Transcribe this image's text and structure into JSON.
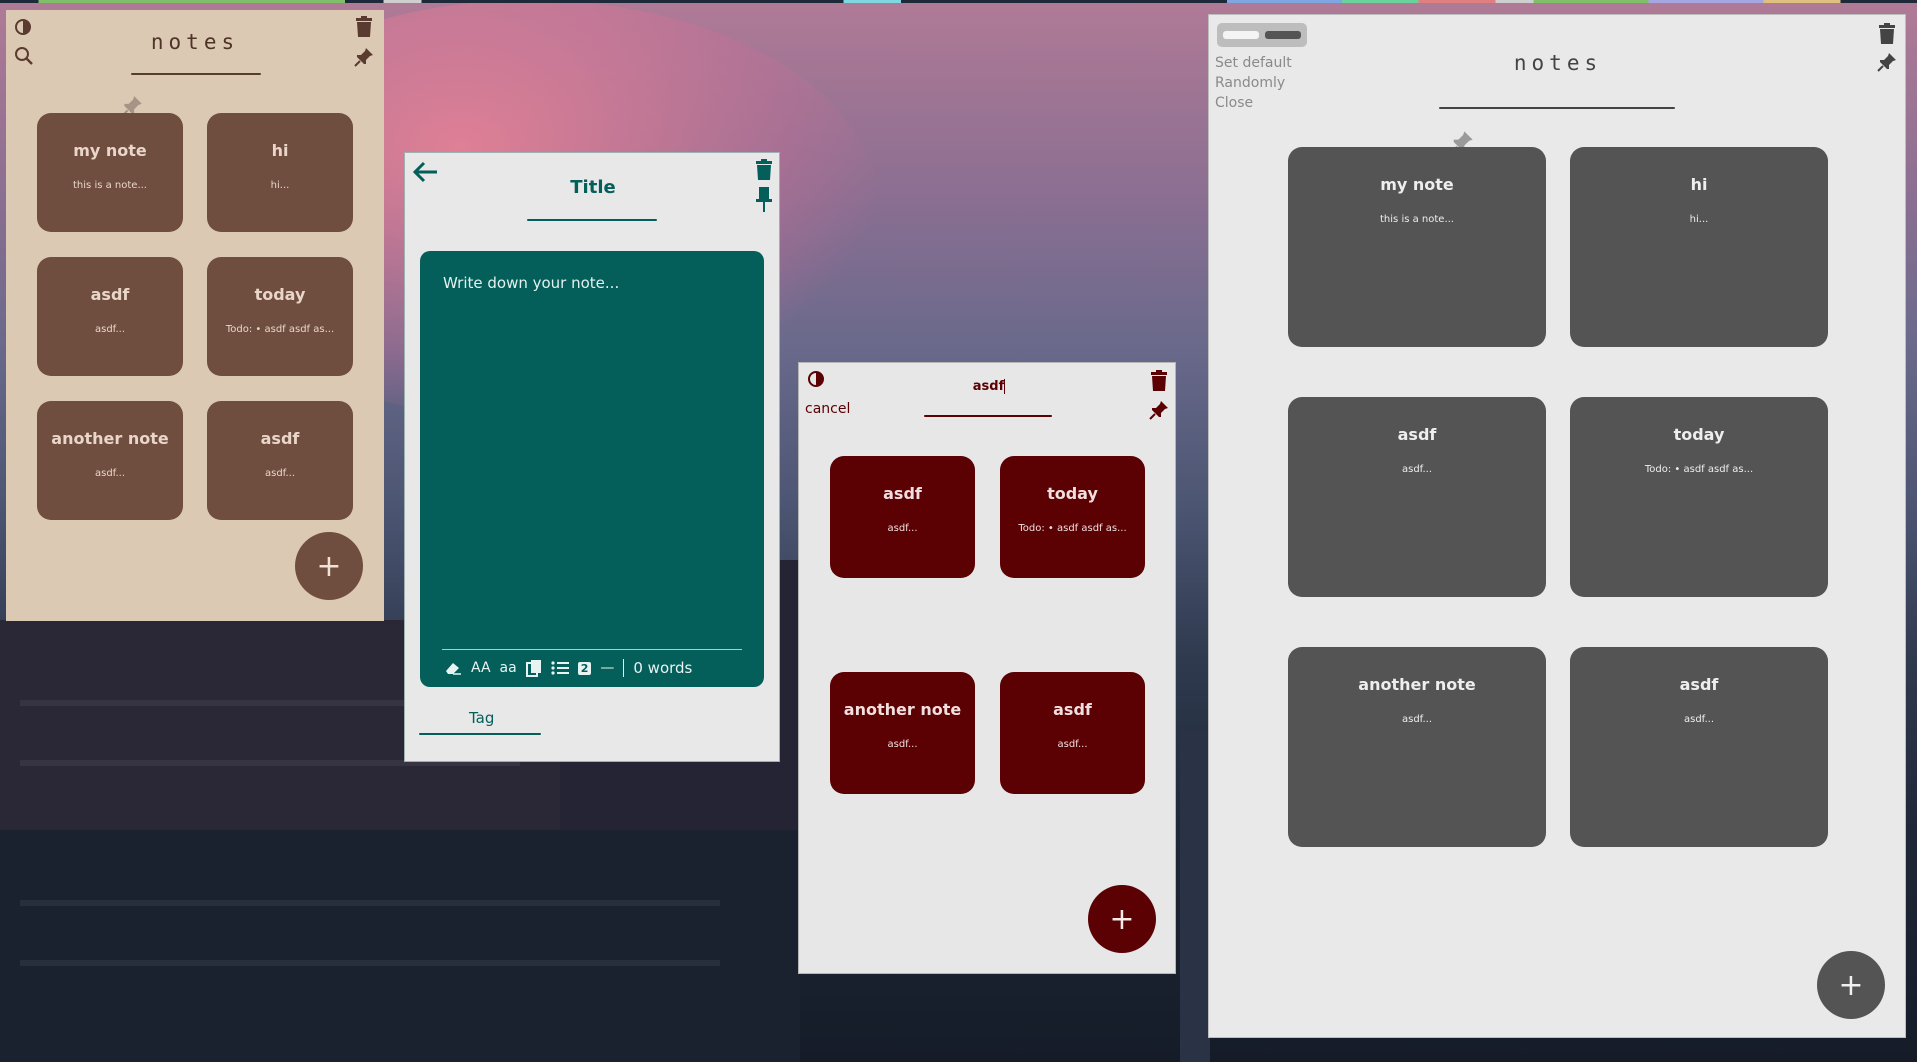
{
  "colors": {
    "tan_bg": "#dcc9b4",
    "tan_card": "#6f4e40",
    "teal": "#045e5a",
    "maroon": "#5b0003",
    "gray_card": "#545454",
    "gray_bg": "#e9e9e9"
  },
  "window_tan": {
    "title": "notes",
    "icons": [
      "contrast-icon",
      "search-icon",
      "trash-icon",
      "pin-icon",
      "pin-icon"
    ],
    "notes": [
      {
        "title": "my note",
        "preview": "this is a note...",
        "pinned": true
      },
      {
        "title": "hi",
        "preview": "hi..."
      },
      {
        "title": "asdf",
        "preview": "asdf..."
      },
      {
        "title": "today",
        "preview": "Todo: • asdf asdf as..."
      },
      {
        "title": "another note",
        "preview": "asdf..."
      },
      {
        "title": "asdf",
        "preview": "asdf..."
      }
    ],
    "fab_label": "+"
  },
  "window_editor": {
    "back_icon": "arrow-left-icon",
    "title_placeholder": "Title",
    "note_placeholder": "Write down your note...",
    "toolbar": {
      "clear_icon": "eraser-icon",
      "uppercase_label": "AA",
      "lowercase_label": "aa",
      "copy_icon": "copy-icon",
      "list_icon": "bullet-list-icon",
      "numbered_label": "2",
      "divider_label": "—",
      "word_count": "0 words"
    },
    "tag_placeholder": "Tag"
  },
  "window_search": {
    "search_value": "asdf",
    "cancel_label": "cancel",
    "notes": [
      {
        "title": "asdf",
        "preview": "asdf..."
      },
      {
        "title": "today",
        "preview": "Todo: • asdf asdf as..."
      },
      {
        "title": "another note",
        "preview": "asdf..."
      },
      {
        "title": "asdf",
        "preview": "asdf..."
      }
    ],
    "fab_label": "+"
  },
  "window_gray": {
    "title": "notes",
    "theme_menu": [
      "Set default",
      "Randomly",
      "Close"
    ],
    "notes": [
      {
        "title": "my note",
        "preview": "this is a note...",
        "pinned": true
      },
      {
        "title": "hi",
        "preview": "hi..."
      },
      {
        "title": "asdf",
        "preview": "asdf..."
      },
      {
        "title": "today",
        "preview": "Todo: • asdf asdf as..."
      },
      {
        "title": "another note",
        "preview": "asdf..."
      },
      {
        "title": "asdf",
        "preview": "asdf..."
      }
    ],
    "fab_label": "+"
  }
}
